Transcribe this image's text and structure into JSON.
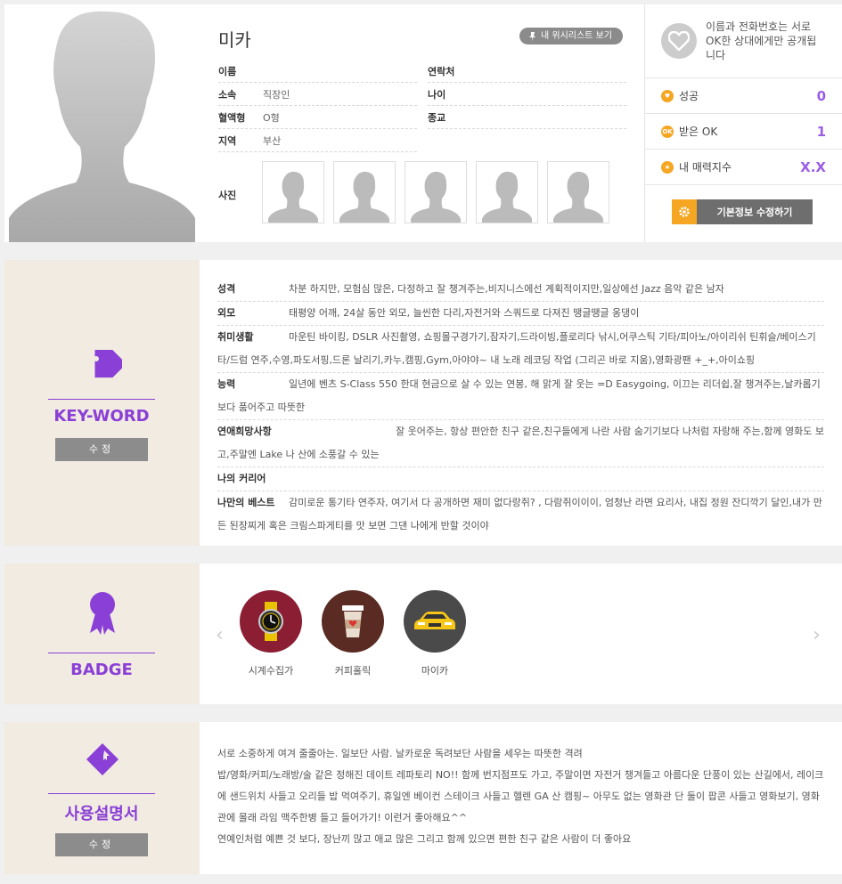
{
  "profile": {
    "name": "미카",
    "wishlist_btn": "내 위시리스트 보기",
    "left_rows": [
      {
        "label": "이름",
        "value": ""
      },
      {
        "label": "소속",
        "value": "직장인"
      },
      {
        "label": "혈액형",
        "value": "O형"
      },
      {
        "label": "지역",
        "value": "부산"
      }
    ],
    "right_rows": [
      {
        "label": "연락처",
        "value": ""
      },
      {
        "label": "나이",
        "value": ""
      },
      {
        "label": "종교",
        "value": ""
      }
    ],
    "photos_label": "사진"
  },
  "side": {
    "note": "이름과 전화번호는 서로OK한 상대에게만 공개됩니다",
    "stats": [
      {
        "label": "성공",
        "value": "0",
        "icon": "heart-icon"
      },
      {
        "label": "받은 OK",
        "value": "1",
        "icon": "ok-icon"
      },
      {
        "label": "내 매력지수",
        "value": "X.X",
        "icon": "star-icon"
      }
    ],
    "edit_btn": "기본정보 수정하기"
  },
  "keyword": {
    "title": "KEY-WORD",
    "edit": "수정",
    "rows": [
      {
        "k": "성격",
        "v": "차분 하지만, 모험심 많은, 다정하고 잘 챙겨주는,비지니스에선 계획적이지만,일상에선 Jazz 음악 같은 남자"
      },
      {
        "k": "외모",
        "v": "태평양 어깨, 24살 동안 외모, 늘씬한 다리,자전거와 스쿼드로 다져진 땡글땡글 옹댕이"
      },
      {
        "k": "취미생활",
        "v": "마운틴 바이킹, DSLR 사진촬영, 쇼핑몰구경가기,잠자기,드라이빙,플로리다 낚시,어쿠스틱 기타/피아노/아이리쉬 틴휘슬/베이스기타/드럼 연주,수영,파도서핑,드론 날리기,카누,캠핑,Gym,아야야~ 내 노래 레코딩 작업 (그리곤 바로 지움),영화광팬 +_+,아이쇼핑"
      },
      {
        "k": "능력",
        "v": "일년에 벤츠 S-Class 550 한대 현금으로 살 수 있는 연봉, 해 맑게 잘 웃는 =D Easygoing, 이끄는 리더쉽,잘 챙겨주는,날카롭기 보다 품어주고 따뜻한"
      },
      {
        "k": "연애희망사항",
        "v": "잘 웃어주는, 항상 편안한 친구 같은,친구들에게 나란 사람 숨기기보다 나처럼 자랑해 주는,함께 영화도 보고,주말엔 Lake 나 산에 소풍갈 수 있는"
      },
      {
        "k": "나의 커리어",
        "v": ""
      },
      {
        "k": "나만의 베스트",
        "v": "감미로운 통기타 연주자, 여기서 다 공개하면 재미 없다랑쥐? , 다람쥐이이이, 엄청난 라면 요리사, 내집 정원 잔디깍기 달인,내가 만든 된장찌게 혹은 크림스파게티를 맛 보면 그댄 나에게 반할 것이야"
      }
    ]
  },
  "badge": {
    "title": "BADGE",
    "items": [
      {
        "label": "시계수집가",
        "color": "#8b1e33"
      },
      {
        "label": "커피홀릭",
        "color": "#5a2b22"
      },
      {
        "label": "마이카",
        "color": "#4a4a4a"
      }
    ]
  },
  "manual": {
    "title": "사용설명서",
    "edit": "수정",
    "lines": [
      "서로 소중하게 여겨 줄줄아는. 일보단 사람. 날카로운 독려보단 사람을 세우는 따뜻한 격려",
      "밥/영화/커피/노래방/술 같은 정해진 데이트 레파토리 NO!! 함께 번지점프도 가고, 주말이면 자전거 챙겨들고 아름다운 단풍이 있는 산길에서, 레이크에 샌드위치 사들고 오리들 밥 먹여주기, 휴일엔 베이컨 스테이크 사들고 헬렌 GA 산 캠핑~ 아무도 없는 영화관 단 둘이 팝콘 사들고 영화보기, 영화관에 몰래 라임 맥주한병 들고 들어가기! 이런거 좋아해요^^",
      "연예인처럼 예쁜 것 보다, 장난끼 많고 애교 많은 그리고 함께 있으면 편한 친구 같은 사람이 더 좋아요"
    ]
  },
  "colors": {
    "accent": "#9b5de5",
    "panel_bg": "#f1ebe2",
    "orange": "#f5a623"
  }
}
